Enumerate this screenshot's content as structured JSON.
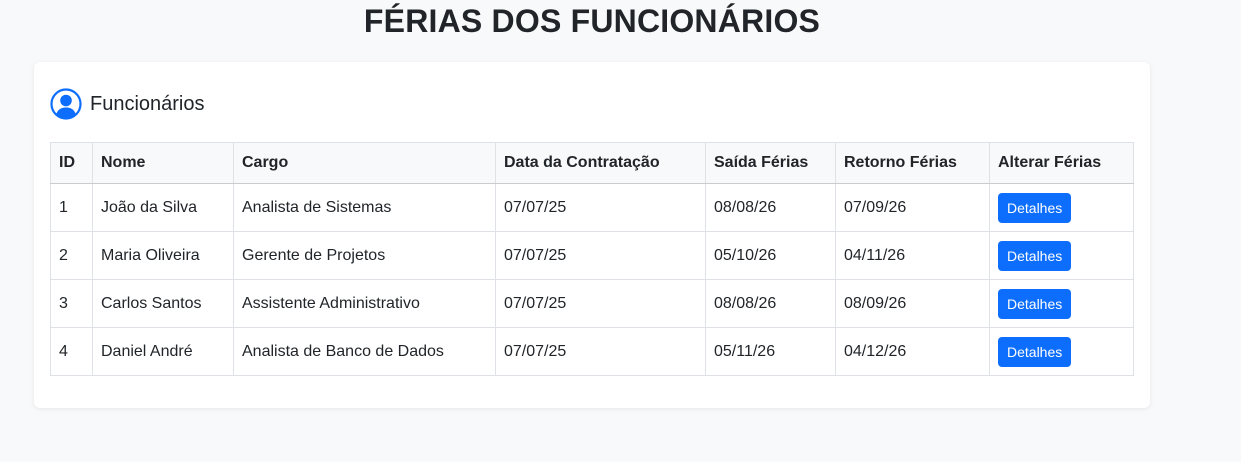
{
  "page": {
    "title": "FÉRIAS DOS FUNCIONÁRIOS"
  },
  "card": {
    "title": "Funcionários",
    "icon": "user-circle-icon"
  },
  "colors": {
    "primary": "#0d6efd",
    "background": "#f8f9fa",
    "border": "#dee2e6"
  },
  "table": {
    "headers": [
      "ID",
      "Nome",
      "Cargo",
      "Data da Contratação",
      "Saída Férias",
      "Retorno Férias",
      "Alterar Férias"
    ],
    "rows": [
      {
        "id": "1",
        "nome": "João da Silva",
        "cargo": "Analista de Sistemas",
        "contratacao": "07/07/25",
        "saida": "08/08/26",
        "retorno": "07/09/26",
        "action": "Detalhes"
      },
      {
        "id": "2",
        "nome": "Maria Oliveira",
        "cargo": "Gerente de Projetos",
        "contratacao": "07/07/25",
        "saida": "05/10/26",
        "retorno": "04/11/26",
        "action": "Detalhes"
      },
      {
        "id": "3",
        "nome": "Carlos Santos",
        "cargo": "Assistente Administrativo",
        "contratacao": "07/07/25",
        "saida": "08/08/26",
        "retorno": "08/09/26",
        "action": "Detalhes"
      },
      {
        "id": "4",
        "nome": "Daniel André",
        "cargo": "Analista de Banco de Dados",
        "contratacao": "07/07/25",
        "saida": "05/11/26",
        "retorno": "04/12/26",
        "action": "Detalhes"
      }
    ]
  }
}
